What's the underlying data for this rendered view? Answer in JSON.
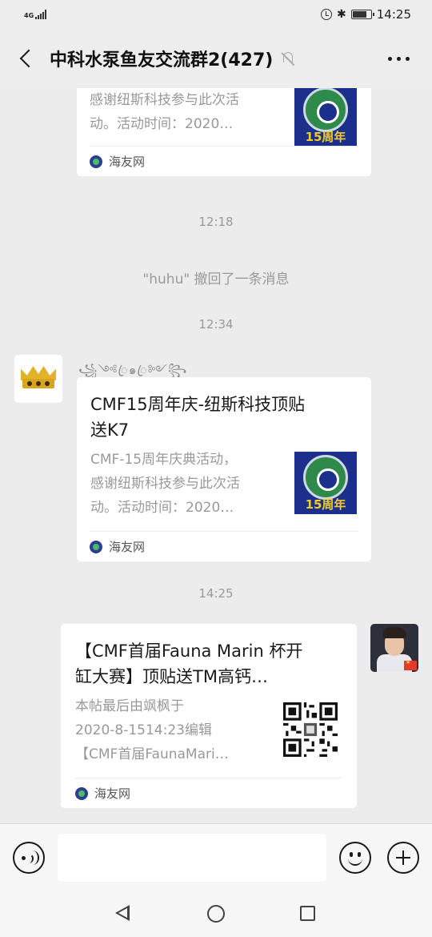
{
  "status_bar": {
    "network": "4G",
    "time": "14:25"
  },
  "header": {
    "title": "中科水泵鱼友交流群2(427)"
  },
  "messages": [
    {
      "type": "link_card",
      "desc": "感谢纽斯科技参与此次活动。活动时间：2020…",
      "desc_lines": [
        "感谢纽斯科技参与此次活",
        "动。活动时间：2020…"
      ],
      "source": "海友网",
      "thumb_text": "15周年"
    },
    {
      "type": "timestamp",
      "text": "12:18"
    },
    {
      "type": "system",
      "text": "\"huhu\" 撤回了一条消息"
    },
    {
      "type": "timestamp",
      "text": "12:34"
    },
    {
      "type": "link_card",
      "sender_name": "꧁༺ꦿ๑ꦿ༻꧂",
      "title_lines": [
        "CMF15周年庆-纽斯科技顶贴",
        "送K7"
      ],
      "desc_lines": [
        "CMF-15周年庆典活动，",
        "感谢纽斯科技参与此次活",
        "动。活动时间：2020…"
      ],
      "source": "海友网",
      "thumb_text": "15周年"
    },
    {
      "type": "timestamp",
      "text": "14:25"
    },
    {
      "type": "link_card",
      "title_lines": [
        "【CMF首届Fauna Marin 杯开",
        "缸大赛】顶贴送TM高钙…"
      ],
      "desc_lines": [
        "本帖最后由飒枫于",
        "2020-8-1514:23编辑",
        "【CMF首届FaunaMari…"
      ],
      "source": "海友网"
    }
  ],
  "input": {
    "placeholder": ""
  }
}
